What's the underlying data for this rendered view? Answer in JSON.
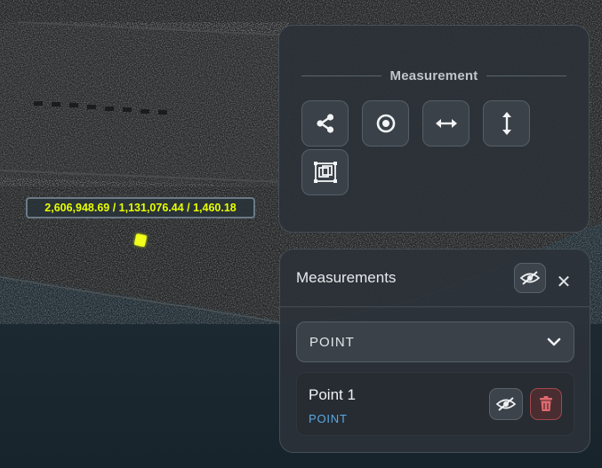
{
  "viewer": {
    "coordinate_label": "2,606,948.69 / 1,131,076.44 / 1,460.18",
    "marker_color": "#f2ff1a"
  },
  "measurement_panel": {
    "title": "Measurement",
    "tools": [
      {
        "icon": "share-nodes-icon"
      },
      {
        "icon": "target-point-icon"
      },
      {
        "icon": "horizontal-arrow-icon"
      },
      {
        "icon": "vertical-arrow-icon"
      },
      {
        "icon": "area-frame-icon"
      }
    ]
  },
  "measurements_panel": {
    "title": "Measurements",
    "close_label": "✕",
    "filter": {
      "selected": "POINT"
    },
    "items": [
      {
        "name": "Point 1",
        "type": "POINT"
      }
    ],
    "colors": {
      "type_text": "#5aa8e6",
      "delete": "#e06a70"
    }
  }
}
